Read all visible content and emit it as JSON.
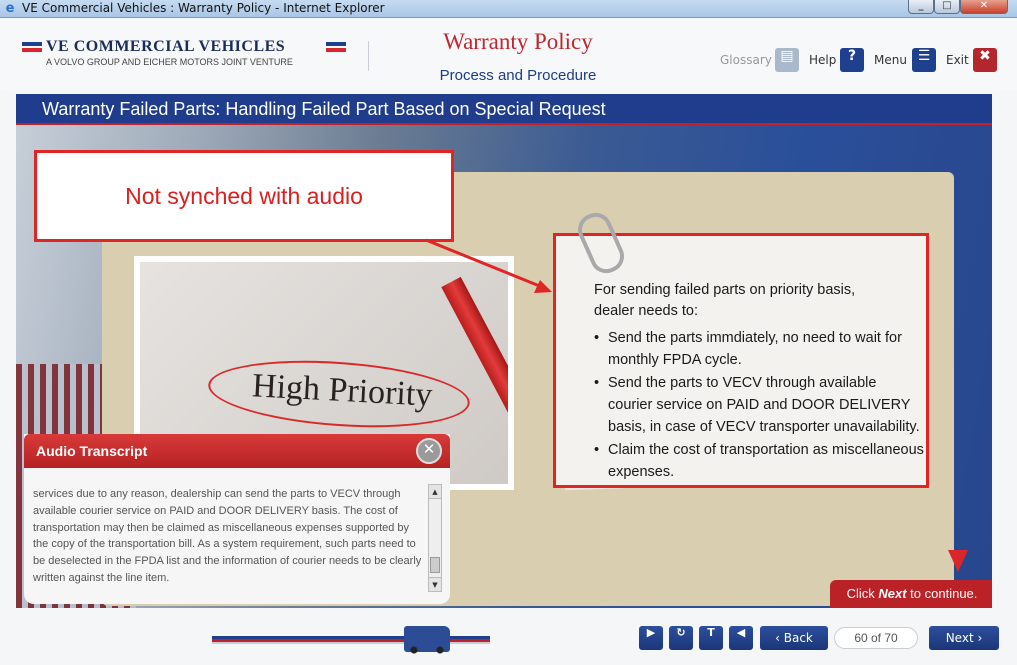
{
  "window": {
    "title": "VE Commercial Vehicles : Warranty Policy - Internet Explorer",
    "min_icon": "minimize-icon",
    "max_icon": "maximize-icon",
    "close_icon": "close-icon"
  },
  "header": {
    "logo_title": "VE COMMERCIAL VEHICLES",
    "logo_subtitle": "A VOLVO GROUP AND EICHER MOTORS JOINT VENTURE",
    "course_title": "Warranty Policy",
    "course_subtitle": "Process and Procedure",
    "tools": {
      "glossary_label": "Glossary",
      "help_label": "Help",
      "help_glyph": "?",
      "menu_label": "Menu",
      "exit_label": "Exit"
    }
  },
  "slide": {
    "title": "Warranty Failed Parts: Handling Failed Part Based on Special Request",
    "callout": "Not synched with audio",
    "image_caption": "High Priority",
    "note_intro": "For sending failed parts on priority basis, dealer needs to:",
    "note_items": [
      "Send the parts immdiately, no need to wait for monthly FPDA cycle.",
      "Send the parts to VECV through available courier service on PAID and DOOR DELIVERY basis, in case of VECV transporter unavailability.",
      "Claim the cost of transportation as miscellaneous expenses."
    ],
    "next_hint": {
      "prefix": "Click ",
      "keyword": "Next",
      "suffix": " to continue."
    }
  },
  "audio_transcript": {
    "title": "Audio Transcript",
    "text": "services due to any reason, dealership can send the parts to VECV through available courier service on PAID and DOOR DELIVERY basis. The cost of transportation may then be claimed as miscellaneous expenses supported by the copy of the transportation bill. As a system requirement, such parts need to be deselected in the FPDA list and the information of courier needs to be clearly written against the line item."
  },
  "footer": {
    "back_label": "Back",
    "next_label": "Next",
    "page_indicator": "60 of 70",
    "progress": 0.857
  },
  "colors": {
    "brand_blue": "#1f3d8c",
    "brand_red": "#c3202a",
    "callout_red": "#e02525"
  }
}
